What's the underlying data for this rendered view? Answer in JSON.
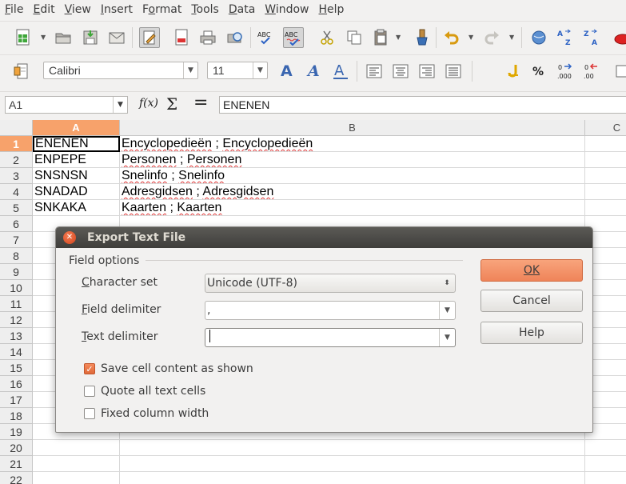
{
  "menubar": {
    "items": [
      "File",
      "Edit",
      "View",
      "Insert",
      "Format",
      "Tools",
      "Data",
      "Window",
      "Help"
    ],
    "underline": [
      "F",
      "E",
      "V",
      "I",
      "o",
      "T",
      "D",
      "W",
      "H"
    ]
  },
  "formatting": {
    "font_name": "Calibri",
    "font_size": "11"
  },
  "formula_bar": {
    "cell_ref": "A1",
    "fx_label": "f(x)",
    "sum_label": "Σ",
    "equals_label": "=",
    "content": "ENENEN"
  },
  "sheet": {
    "columns": [
      "A",
      "B",
      "C"
    ],
    "rows": [
      "1",
      "2",
      "3",
      "4",
      "5",
      "6",
      "7",
      "8",
      "9",
      "10",
      "11",
      "12",
      "13",
      "14",
      "15",
      "16",
      "17",
      "18",
      "19",
      "20",
      "21",
      "22"
    ],
    "cells": [
      {
        "a": "ENENEN",
        "b1": "Encyclopedieën",
        "b2": "Encyclopedieën"
      },
      {
        "a": "ENPEPE",
        "b1": "Personen",
        "b2": "Personen"
      },
      {
        "a": "SNSNSN",
        "b1": "Snelinfo",
        "b2": "Snelinfo"
      },
      {
        "a": "SNADAD",
        "b1": "Adresgidsen",
        "b2": "Adresgidsen"
      },
      {
        "a": "SNKAKA",
        "b1": "Kaarten",
        "b2": "Kaarten"
      }
    ],
    "separator": " ; "
  },
  "dialog": {
    "title": "Export Text File",
    "group_label": "Field options",
    "character_set_label": "Character set",
    "character_set_value": "Unicode (UTF-8)",
    "field_delimiter_label": "Field delimiter",
    "field_delimiter_value": ",",
    "text_delimiter_label": "Text delimiter",
    "text_delimiter_value": "",
    "checkboxes": [
      {
        "label": "Save cell content as shown",
        "checked": true
      },
      {
        "label": "Quote all text cells",
        "checked": false
      },
      {
        "label": "Fixed column width",
        "checked": false
      }
    ],
    "ok_label": "OK",
    "cancel_label": "Cancel",
    "help_label": "Help"
  },
  "colors": {
    "accent": "#f7a26b",
    "ok_button": "#ef8459",
    "spell_error": "#dd3333"
  },
  "icons": {
    "toolbar1": [
      "new-document-icon",
      "open-folder-icon",
      "save-icon",
      "email-icon",
      "edit-mode-icon",
      "export-pdf-icon",
      "print-icon",
      "print-preview-icon",
      "spellcheck-icon",
      "autospellcheck-icon",
      "cut-icon",
      "copy-icon",
      "paste-icon",
      "clone-formatting-icon",
      "undo-icon",
      "redo-icon",
      "navigator-icon",
      "sort-ascending-icon",
      "sort-descending-icon"
    ],
    "toolbar2": [
      "styles-icon",
      "bold-icon",
      "italic-icon",
      "underline-icon",
      "align-left-icon",
      "align-center-icon",
      "align-right-icon",
      "justify-icon",
      "currency-icon",
      "percent-icon",
      "decimal-add-icon",
      "decimal-remove-icon"
    ]
  }
}
